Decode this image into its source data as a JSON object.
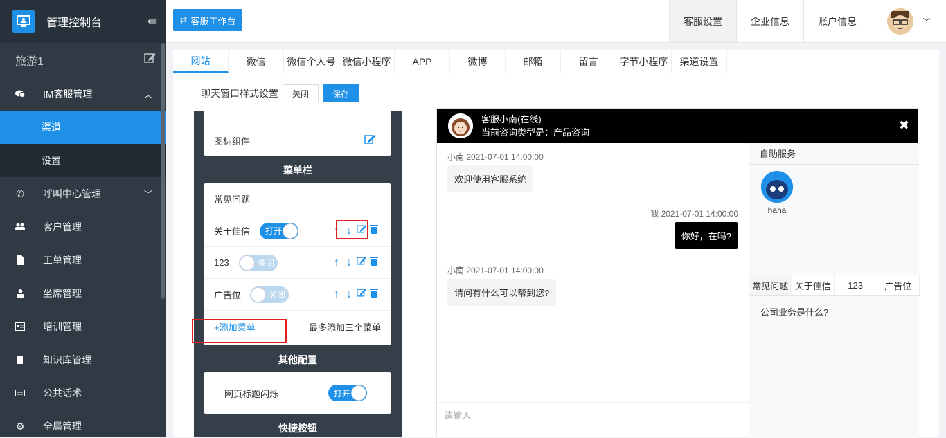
{
  "sidebar": {
    "title": "管理控制台",
    "tenant": "旅游1",
    "items": [
      {
        "label": "IM客服管理",
        "icon": "chat-icon"
      },
      {
        "label": "呼叫中心管理",
        "icon": "phone-icon"
      },
      {
        "label": "客户管理",
        "icon": "users-icon"
      },
      {
        "label": "工单管理",
        "icon": "document-icon"
      },
      {
        "label": "坐席管理",
        "icon": "user-icon"
      },
      {
        "label": "培训管理",
        "icon": "idcard-icon"
      },
      {
        "label": "知识库管理",
        "icon": "book-icon"
      },
      {
        "label": "公共话术",
        "icon": "keyboard-icon"
      },
      {
        "label": "全局管理",
        "icon": "gear-icon"
      }
    ],
    "sub_items": [
      "渠道",
      "设置"
    ]
  },
  "topbar": {
    "workspace_button": "客服工作台",
    "nav": [
      "客服设置",
      "企业信息",
      "账户信息"
    ]
  },
  "tabs": [
    "网站",
    "微信",
    "微信个人号",
    "微信小程序",
    "APP",
    "微博",
    "邮箱",
    "留言",
    "字节小程序",
    "渠道设置"
  ],
  "style_bar": {
    "title": "聊天窗口样式设置",
    "close": "关闭",
    "save": "保存"
  },
  "panel": {
    "icon_component": "图标组件",
    "menu_title": "菜单栏",
    "menu_header": "常见问题",
    "menus": [
      {
        "label": "关于佳信",
        "toggle": "打开",
        "on": true
      },
      {
        "label": "123",
        "toggle": "关闭",
        "on": false
      },
      {
        "label": "广告位",
        "toggle": "关闭",
        "on": false
      }
    ],
    "add_menu": "+添加菜单",
    "add_hint": "最多添加三个菜单",
    "other_title": "其他配置",
    "flash_label": "网页标题闪烁",
    "flash_toggle": "打开",
    "quick_title": "快捷按钮"
  },
  "chat": {
    "agent": "客服小南(在线)",
    "consult": "当前咨询类型是：产品咨询",
    "messages": [
      {
        "meta": "小南 2021-07-01 14:00:00",
        "text": "欢迎使用客服系统",
        "side": "left"
      },
      {
        "meta": "我 2021-07-01 14:00:00",
        "text": "你好，在吗?",
        "side": "right"
      },
      {
        "meta": "小南 2021-07-01 14:00:00",
        "text": "请问有什么可以帮到您?",
        "side": "left"
      }
    ],
    "input_placeholder": "请输入",
    "self_service": "自助服务",
    "robot_name": "haha",
    "qtabs": [
      "常见问题",
      "关于佳信",
      "123",
      "广告位"
    ],
    "question": "公司业务是什么?"
  },
  "colors": {
    "primary": "#1e90e8",
    "sidebar": "#2f3a45",
    "highlight": "#e02020"
  }
}
